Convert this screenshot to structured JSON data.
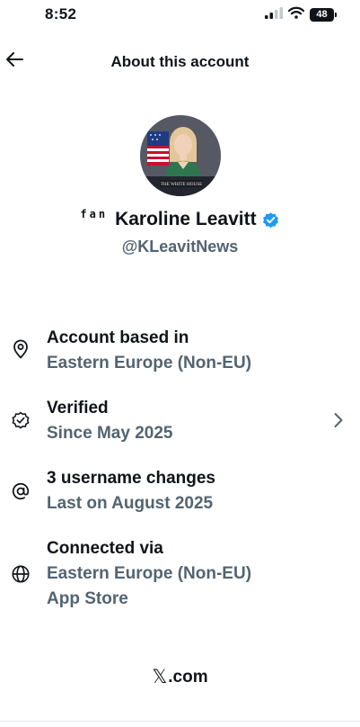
{
  "status_bar": {
    "time": "8:52",
    "battery": "48"
  },
  "nav": {
    "title": "About this account"
  },
  "profile": {
    "prefix": "fan",
    "display_name": "Karoline Leavitt",
    "handle": "@KLeavitNews",
    "avatar_podium_text": "THE WHITE HOUSE"
  },
  "rows": [
    {
      "icon": "location-pin-icon",
      "title": "Account based in",
      "subtitle": "Eastern Europe (Non-EU)"
    },
    {
      "icon": "verified-badge-icon",
      "title": "Verified",
      "subtitle": "Since May 2025"
    },
    {
      "icon": "at-sign-icon",
      "title": "3 username changes",
      "subtitle": "Last on August 2025"
    },
    {
      "icon": "globe-icon",
      "title": "Connected via",
      "subtitle": "Eastern Europe (Non-EU)",
      "subtitle2": "App Store"
    }
  ],
  "footer": {
    "logo": "𝕏",
    "text": ".com"
  },
  "colors": {
    "text": "#0f1419",
    "secondary": "#536471",
    "verified_blue": "#1d9bf0"
  }
}
